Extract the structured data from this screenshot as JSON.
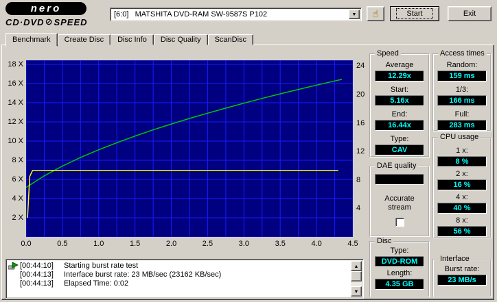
{
  "header": {
    "logo": {
      "name": "nero",
      "product_left": "CD·DVD",
      "product_right": "SPEED"
    },
    "drive_select": {
      "value": "[6:0]   MATSHITA DVD-RAM SW-9587S P102"
    },
    "start_button": "Start",
    "exit_button": "Exit"
  },
  "tabs": {
    "items": [
      {
        "label": "Benchmark",
        "active": true
      },
      {
        "label": "Create Disc",
        "active": false
      },
      {
        "label": "Disc Info",
        "active": false
      },
      {
        "label": "Disc Quality",
        "active": false
      },
      {
        "label": "ScanDisc",
        "active": false
      }
    ]
  },
  "chart_data": {
    "type": "line",
    "bg_color": "#000080",
    "grid_color": "#1a1aff",
    "x_range": [
      0,
      4.5
    ],
    "x_ticks": [
      0.0,
      0.5,
      1.0,
      1.5,
      2.0,
      2.5,
      3.0,
      3.5,
      4.0,
      4.5
    ],
    "x_minor_step": 0.25,
    "y_left_range": [
      0,
      18.43
    ],
    "y_left_ticks": [
      2,
      4,
      6,
      8,
      10,
      12,
      14,
      16,
      18
    ],
    "y_left_suffix": " X",
    "y_right_range": [
      0,
      24.8
    ],
    "y_right_ticks": [
      4,
      8,
      12,
      16,
      20,
      24
    ],
    "series": [
      {
        "name": "read-speed-curve",
        "color": "#00c800",
        "points": [
          [
            0,
            5.16
          ],
          [
            0.25,
            6.37
          ],
          [
            0.5,
            7.39
          ],
          [
            0.75,
            8.29
          ],
          [
            1.0,
            9.09
          ],
          [
            1.25,
            9.83
          ],
          [
            1.5,
            10.52
          ],
          [
            1.75,
            11.17
          ],
          [
            2.0,
            11.78
          ],
          [
            2.25,
            12.36
          ],
          [
            2.5,
            12.91
          ],
          [
            2.75,
            13.44
          ],
          [
            3.0,
            13.95
          ],
          [
            3.25,
            14.45
          ],
          [
            3.5,
            14.93
          ],
          [
            3.75,
            15.39
          ],
          [
            4.0,
            15.84
          ],
          [
            4.25,
            16.27
          ],
          [
            4.35,
            16.44
          ]
        ]
      },
      {
        "name": "burst-rate-line",
        "color": "#ffff00",
        "points": [
          [
            0.02,
            2.0
          ],
          [
            0.05,
            6.3
          ],
          [
            0.09,
            6.95
          ],
          [
            4.3,
            6.95
          ]
        ]
      }
    ]
  },
  "panels": {
    "speed": {
      "title": "Speed",
      "items": [
        {
          "label": "Average",
          "value": "12.29x"
        },
        {
          "label": "Start:",
          "value": "5.16x"
        },
        {
          "label": "End:",
          "value": "16.44x"
        },
        {
          "label": "Type:",
          "value": "CAV"
        }
      ]
    },
    "access_times": {
      "title": "Access times",
      "items": [
        {
          "label": "Random:",
          "value": "159 ms"
        },
        {
          "label": "1/3:",
          "value": "166 ms"
        },
        {
          "label": "Full:",
          "value": "283 ms"
        }
      ]
    },
    "cpu_usage": {
      "title": "CPU usage",
      "items": [
        {
          "label": "1 x:",
          "value": "8 %"
        },
        {
          "label": "2 x:",
          "value": "16 %"
        },
        {
          "label": "4 x:",
          "value": "40 %"
        },
        {
          "label": "8 x:",
          "value": "56 %"
        }
      ]
    },
    "dae_quality": {
      "title": "DAE quality",
      "value": "",
      "accurate_stream_label": "Accurate stream",
      "checkbox_checked": false
    },
    "disc": {
      "title": "Disc",
      "items": [
        {
          "label": "Type:",
          "value": "DVD-ROM"
        },
        {
          "label": "Length:",
          "value": "4.35 GB"
        }
      ]
    },
    "interface": {
      "title": "Interface",
      "items": [
        {
          "label": "Burst rate:",
          "value": "23 MB/s"
        }
      ]
    }
  },
  "log": {
    "lines": [
      {
        "time": "[00:44:10]",
        "text": "Starting burst rate test",
        "icon": "test-start-icon"
      },
      {
        "time": "[00:44:13]",
        "text": "Interface burst rate: 23 MB/sec (23162 KB/sec)",
        "icon": ""
      },
      {
        "time": "[00:44:13]",
        "text": "Elapsed Time: 0:02",
        "icon": ""
      }
    ]
  }
}
